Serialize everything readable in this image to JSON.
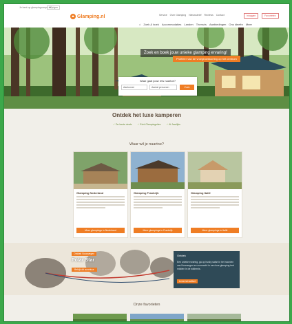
{
  "utility": {
    "text": "Je bent op glampingcamps.nl",
    "select": "Wijzigen"
  },
  "brand": {
    "name": "Glamping.nl",
    "accent": "#ef7d24"
  },
  "toplinks": [
    "Service",
    "Over Glamping",
    "Nieuwsbrief",
    "Reviews",
    "Contact"
  ],
  "header_buttons": {
    "login": "Inloggen",
    "cart": "Favorieten"
  },
  "nav": [
    "Zoek & boek",
    "Accommodaties",
    "Landen",
    "Thema's",
    "Aanbiedingen",
    "Ons ideeën",
    "Meer"
  ],
  "hero": {
    "promo": "Zoek en boek jouw unieke glamping ervaring!",
    "promo_sub": "Profiteer van de vroegboekkorting op het centrum",
    "search": {
      "title": "Waar gaat jouw reis naartoe?",
      "arrival": "Aankomst",
      "duration": "Aantal personen",
      "button": "Zoek"
    }
  },
  "discover": {
    "title": "Ontdek het luxe kamperen",
    "usps": [
      "De beste deals",
      "Echt Glampingsites",
      "Al Jaarlijks"
    ]
  },
  "where": {
    "title": "Waar wil je naartoe?",
    "cards": [
      {
        "title": "Glamping Nederland",
        "cta": "Meer glampings in Nederland"
      },
      {
        "title": "Glamping Frankrijk",
        "cta": "Meer glampings in Frankrijk"
      },
      {
        "title": "Glamping Italië",
        "cta": "Meer glampings in Italië"
      }
    ]
  },
  "feature": {
    "label": "Ontdek Noorwegen",
    "title": "Polar Star",
    "button": "Bekijk dit avontuur",
    "info": {
      "heading": "Ontdek",
      "text": "Een unieke ervaring, ga op husky safari in het noorden van Noorwegen en overnacht in een luxe glamping tent midden in de wildernis.",
      "link": "Lees het artikel"
    }
  },
  "favorites": {
    "title": "Onze favorieten"
  }
}
